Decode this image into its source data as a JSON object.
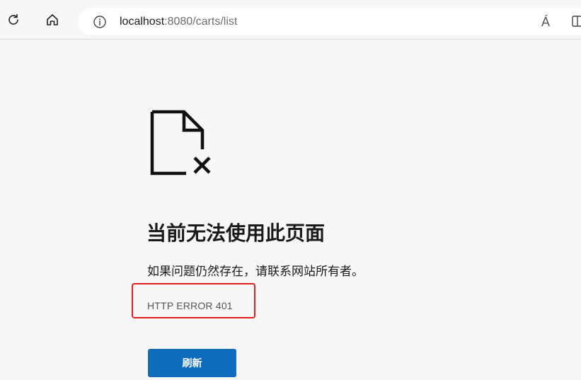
{
  "browser": {
    "url_host": "localhost",
    "url_path": ":8080/carts/list",
    "read_aloud_label": "Á"
  },
  "page": {
    "title": "当前无法使用此页面",
    "message": "如果问题仍然存在，请联系网站所有者。",
    "error_code": "HTTP ERROR 401",
    "refresh_label": "刷新"
  },
  "icons": {
    "reload": "reload-icon",
    "home": "home-icon",
    "info": "info-icon",
    "read_aloud": "read-aloud-icon",
    "split_screen": "split-screen-icon",
    "error": "broken-document-icon"
  },
  "colors": {
    "background": "#f7f7f7",
    "button": "#0f6cbd",
    "highlight_box": "#e02020"
  }
}
